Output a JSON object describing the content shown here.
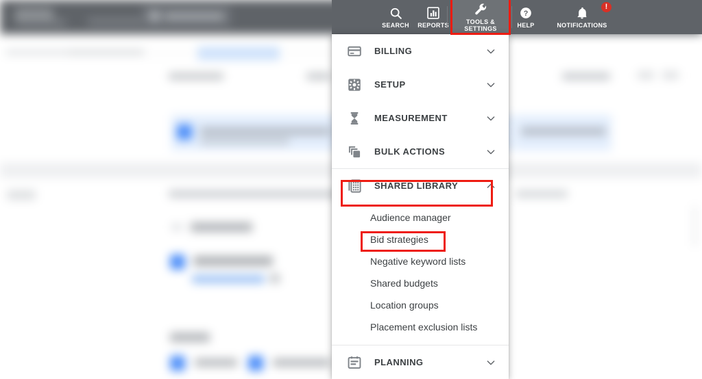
{
  "topbar": {
    "background_color": "#5f6368",
    "nav_items": [
      {
        "name": "search",
        "label": "SEARCH",
        "icon": "search-icon"
      },
      {
        "name": "reports",
        "label": "REPORTS",
        "icon": "reports-bar-chart-icon"
      },
      {
        "name": "tools",
        "label": "TOOLS &\nSETTINGS",
        "icon": "wrench-icon",
        "active": true
      },
      {
        "name": "help",
        "label": "HELP",
        "icon": "help-question-icon"
      },
      {
        "name": "notifications",
        "label": "NOTIFICATIONS",
        "icon": "bell-icon",
        "badge": "!"
      }
    ],
    "notification_badge": "!",
    "badge_color": "#d93025"
  },
  "dropdown": {
    "sections": [
      {
        "name": "billing",
        "label": "BILLING",
        "icon": "credit-card-icon",
        "chevron": "chevron-down-icon",
        "expanded": false
      },
      {
        "name": "setup",
        "label": "SETUP",
        "icon": "gear-square-icon",
        "chevron": "chevron-down-icon",
        "expanded": false
      },
      {
        "name": "measurement",
        "label": "MEASUREMENT",
        "icon": "hourglass-icon",
        "chevron": "chevron-down-icon",
        "expanded": false
      },
      {
        "name": "bulk-actions",
        "label": "BULK ACTIONS",
        "icon": "stacked-layers-icon",
        "chevron": "chevron-down-icon",
        "expanded": false
      },
      {
        "name": "shared-library",
        "label": "SHARED LIBRARY",
        "icon": "library-grid-icon",
        "chevron": "chevron-up-icon",
        "expanded": true,
        "highlighted": true
      },
      {
        "name": "planning",
        "label": "PLANNING",
        "icon": "clipboard-icon",
        "chevron": "chevron-down-icon",
        "expanded": false
      }
    ],
    "shared_library_items": [
      {
        "name": "audience-manager",
        "label": "Audience manager"
      },
      {
        "name": "bid-strategies",
        "label": "Bid strategies",
        "highlighted": true
      },
      {
        "name": "negative-keyword-lists",
        "label": "Negative keyword lists"
      },
      {
        "name": "shared-budgets",
        "label": "Shared budgets"
      },
      {
        "name": "location-groups",
        "label": "Location groups"
      },
      {
        "name": "placement-exclusion-lists",
        "label": "Placement exclusion lists"
      }
    ]
  },
  "annotations": {
    "color": "#ee1c12",
    "boxes": [
      {
        "name": "tools-settings-highlight",
        "target": "TOOLS & SETTINGS"
      },
      {
        "name": "shared-library-highlight",
        "target": "SHARED LIBRARY"
      },
      {
        "name": "bid-strategies-highlight",
        "target": "Bid strategies"
      }
    ]
  }
}
